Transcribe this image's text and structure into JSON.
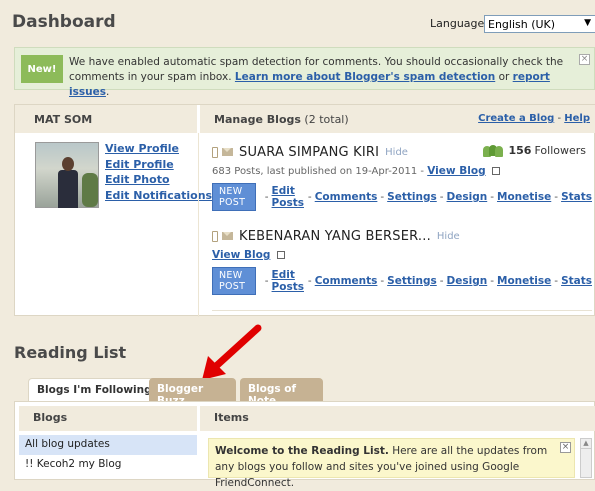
{
  "header": {
    "title": "Dashboard",
    "language_label": "Language:",
    "language_value": "English (UK)"
  },
  "notice": {
    "badge": "New!",
    "text": "We have enabled automatic spam detection for comments. You should occasionally check the comments in your spam inbox.",
    "learn_more": "Learn more about Blogger's spam detection",
    "or": "or",
    "report": "report issues",
    "period": ".",
    "close": "×"
  },
  "profile": {
    "name": "MAT SOM",
    "links": [
      "View Profile",
      "Edit Profile",
      "Edit Photo",
      "Edit Notifications"
    ]
  },
  "manage": {
    "title": "Manage Blogs",
    "count": "(2 total)",
    "create_blog": "Create a Blog",
    "separator": "-",
    "help": "Help"
  },
  "blogs": [
    {
      "name": "SUARA SIMPANG KIRI",
      "hide": "Hide",
      "meta": "683 Posts, last published on 19-Apr-2011 -",
      "view_blog": "View Blog",
      "followers_count": "156",
      "followers_label": "Followers"
    },
    {
      "name": "KEBENARAN YANG BERSER...",
      "hide": "Hide",
      "view_blog": "View Blog"
    }
  ],
  "blog_actions": {
    "new_post": "NEW POST",
    "separator": "-",
    "items": [
      "Edit Posts",
      "Comments",
      "Settings",
      "Design",
      "Monetise",
      "Stats"
    ]
  },
  "reading": {
    "title": "Reading List",
    "tabs": [
      "Blogs I'm Following",
      "Blogger Buzz",
      "Blogs of Note"
    ],
    "blogs_head": "Blogs",
    "items_head": "Items",
    "blog_list": [
      "All blog updates",
      "!! Kecoh2 my Blog"
    ],
    "welcome_bold": "Welcome to the Reading List.",
    "welcome_text": "Here are all the updates from any blogs you follow and sites you've joined using Google FriendConnect.",
    "close": "×"
  },
  "colors": {
    "background": "#f1ebdd",
    "link": "#2b5fa8",
    "new_badge": "#8dbb5a",
    "new_post_button": "#5f8fd6",
    "tab_inactive": "#c6b293",
    "annotation_arrow": "#e00000"
  }
}
